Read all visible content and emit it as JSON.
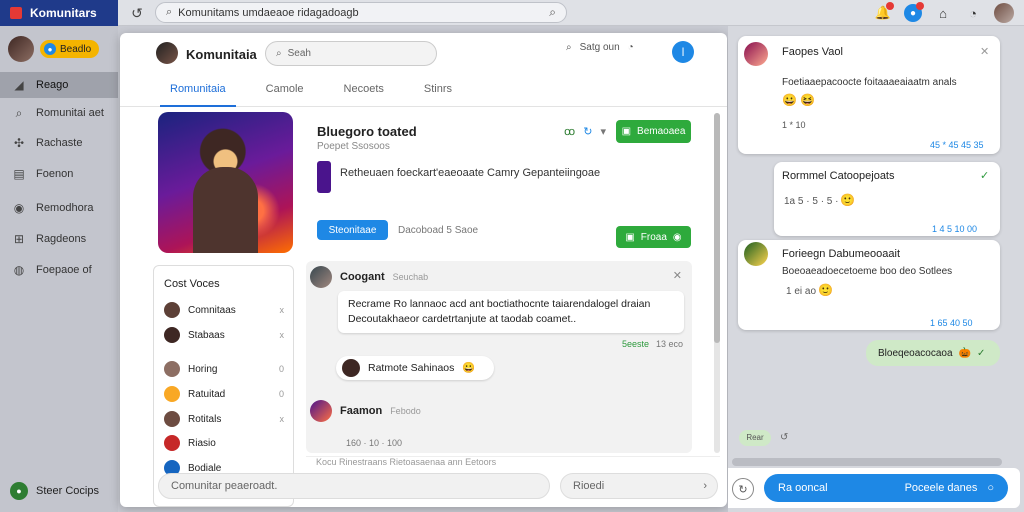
{
  "app": {
    "title": "Komunitars"
  },
  "topbar": {
    "search_text": "Komunitams umdaeaoe ridagadoagb"
  },
  "sidebar": {
    "profile_badge": "Beadlo",
    "items": [
      {
        "label": "Reago",
        "icon": "home-icon"
      },
      {
        "label": "Romunitai aet",
        "icon": "search-icon"
      },
      {
        "label": "Rachaste",
        "icon": "puzzle-icon"
      },
      {
        "label": "Foenon",
        "icon": "list-icon"
      },
      {
        "label": "Remodhora",
        "icon": "circle-icon"
      },
      {
        "label": "Ragdeons",
        "icon": "grid-icon"
      },
      {
        "label": "Foepaoe of",
        "icon": "settings-icon"
      }
    ],
    "footer_label": "Steer Cocips"
  },
  "panel": {
    "title": "Komunitaia",
    "search_placeholder": "Seah",
    "search2_text": "Satg oun",
    "tabs": [
      "Romunitaia",
      "Camole",
      "Necoets",
      "Stinrs"
    ],
    "game": {
      "name": "Bluegoro toated",
      "sub": "Poepet Ssosoos",
      "primary_button": "Bemaoaea",
      "description": "Retheuaen foeckart'eaeoaate Camry Gepanteiingoae",
      "join_button": "Steonitaae",
      "link_text": "Dacoboad 5 Saoe",
      "secondary_button": "Froaa"
    },
    "friends": {
      "heading": "Cost Voces",
      "items": [
        {
          "name": "Comnitaas",
          "x": "x"
        },
        {
          "name": "Stabaas",
          "x": "x"
        },
        {
          "name": "Horing",
          "x": "0"
        },
        {
          "name": "Ratuitad",
          "x": "0"
        },
        {
          "name": "Rotitals",
          "x": "x"
        },
        {
          "name": "Riasio",
          "x": ""
        },
        {
          "name": "Bodiale",
          "x": ""
        }
      ]
    },
    "thread": {
      "author1": "Coogant",
      "author1_meta": "Seuchab",
      "message1_line1": "Recrame Ro lannaoc acd ant boctiathocnte taiarendalogel draian",
      "message1_line2": "Decoutakhaeor cardetrtanjute at taodab coamet..",
      "meta1_a": "5eeste",
      "meta1_b": "13 eco",
      "reply_text": "Ratmote Sahinaos",
      "author2": "Faamon",
      "author2_meta": "Febodo",
      "meta2": "160 · 10 · 100"
    },
    "compose_hint": "Kocu Rinestraans Rietoasaenaa ann Eetoors",
    "input_placeholder": "Comunitar peaeroadt.",
    "input2_placeholder": "Rioedi"
  },
  "right": {
    "cards": [
      {
        "name": "Faopes Vaol",
        "text": "Foetiaaepacoocte foitaaaeaiaatm anals",
        "emoji": "😀 😆",
        "time1": "1 * 10",
        "time2": "45 * 45  45 35"
      },
      {
        "name": "Rormmel Catoopejoats",
        "text": "",
        "emoji": "🙂",
        "time1": "1a 5 · 5 · 5 ·",
        "time2": "1 4 5  10 00"
      },
      {
        "name": "Forieegn Dabumeooaait",
        "text": "Boeoaeadoecetoeme boo deo Sotlees",
        "emoji": "🙂",
        "time1": "1 ei ao",
        "time2": "1 65  40 50"
      }
    ],
    "green_bubble": "Bloeqeoacocaoa",
    "small_bubble": "Rear",
    "send_left": "Ra ooncal",
    "send_right": "Poceele danes"
  }
}
